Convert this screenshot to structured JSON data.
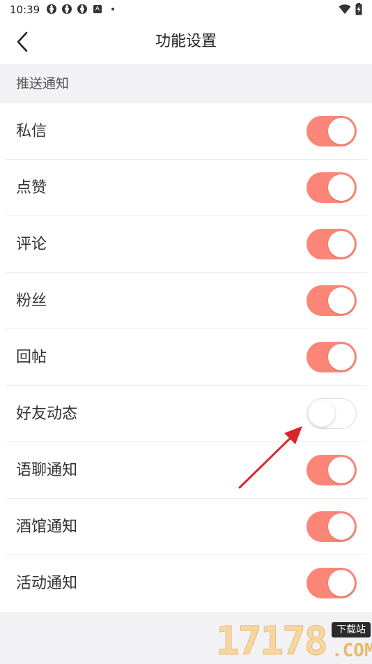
{
  "status_bar": {
    "time": "10:39",
    "icons": [
      "sync-circle-icon",
      "sync-circle-icon",
      "sync-circle-icon",
      "a-badge-icon",
      "dot-icon"
    ],
    "a_badge": "A",
    "right_icons": [
      "wifi-icon",
      "battery-charging-icon"
    ]
  },
  "nav": {
    "title": "功能设置",
    "back_icon": "chevron-left-icon"
  },
  "section": {
    "title": "推送通知"
  },
  "settings": [
    {
      "label": "私信",
      "enabled": true
    },
    {
      "label": "点赞",
      "enabled": true
    },
    {
      "label": "评论",
      "enabled": true
    },
    {
      "label": "粉丝",
      "enabled": true
    },
    {
      "label": "回帖",
      "enabled": true
    },
    {
      "label": "好友动态",
      "enabled": false
    },
    {
      "label": "语聊通知",
      "enabled": true
    },
    {
      "label": "酒馆通知",
      "enabled": true
    },
    {
      "label": "活动通知",
      "enabled": true
    }
  ],
  "colors": {
    "toggle_on": "#fb8577",
    "toggle_off": "#ffffff",
    "annotation_arrow": "#d9262b",
    "section_bg": "#f2f2f4"
  },
  "watermark": {
    "number": "17178",
    "tag": "下载站",
    "suffix": ".COM"
  }
}
